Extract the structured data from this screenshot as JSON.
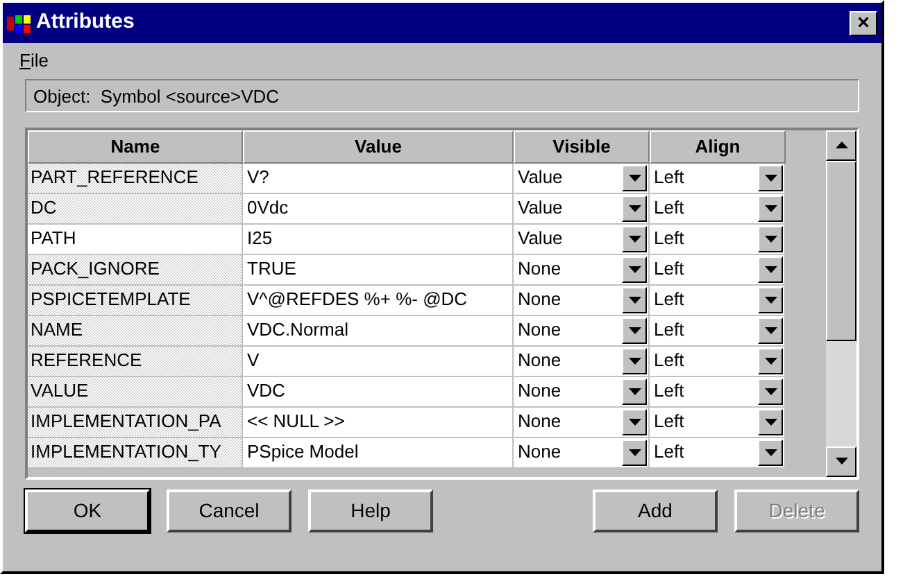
{
  "window": {
    "title": "Attributes",
    "close": "×"
  },
  "menu": [
    {
      "label": "File"
    }
  ],
  "object_field": {
    "value": "Object:  Symbol <source>VDC"
  },
  "table": {
    "columns": [
      "Name",
      "Value",
      "Visible",
      "Align"
    ],
    "rows": [
      {
        "name": "PART_REFERENCE",
        "read_only": true,
        "value": "V?",
        "visible": "Value",
        "align": "Left"
      },
      {
        "name": "DC",
        "read_only": true,
        "value": "0Vdc",
        "visible": "Value",
        "align": "Left"
      },
      {
        "name": "PATH",
        "read_only": false,
        "value": "I25",
        "visible": "Value",
        "align": "Left"
      },
      {
        "name": "PACK_IGNORE",
        "read_only": true,
        "value": "TRUE",
        "visible": "None",
        "align": "Left"
      },
      {
        "name": "PSPICETEMPLATE",
        "read_only": true,
        "value": "V^@REFDES %+ %- @DC",
        "visible": "None",
        "align": "Left"
      },
      {
        "name": "NAME",
        "read_only": true,
        "value": "VDC.Normal",
        "visible": "None",
        "align": "Left"
      },
      {
        "name": "REFERENCE",
        "read_only": true,
        "value": "V",
        "visible": "None",
        "align": "Left"
      },
      {
        "name": "VALUE",
        "read_only": true,
        "value": "VDC",
        "visible": "None",
        "align": "Left"
      },
      {
        "name": "IMPLEMENTATION_PA",
        "read_only": true,
        "value": "<< NULL >>",
        "visible": "None",
        "align": "Left"
      },
      {
        "name": "IMPLEMENTATION_TY",
        "read_only": true,
        "value": "PSpice Model",
        "visible": "None",
        "align": "Left"
      }
    ]
  },
  "buttons": [
    {
      "label": "OK",
      "default": true,
      "disabled": false
    },
    {
      "label": "Cancel",
      "default": false,
      "disabled": false
    },
    {
      "label": "Help",
      "default": false,
      "disabled": false
    },
    {
      "label": "Add",
      "default": false,
      "disabled": false
    },
    {
      "label": "Delete",
      "default": false,
      "disabled": true
    }
  ]
}
